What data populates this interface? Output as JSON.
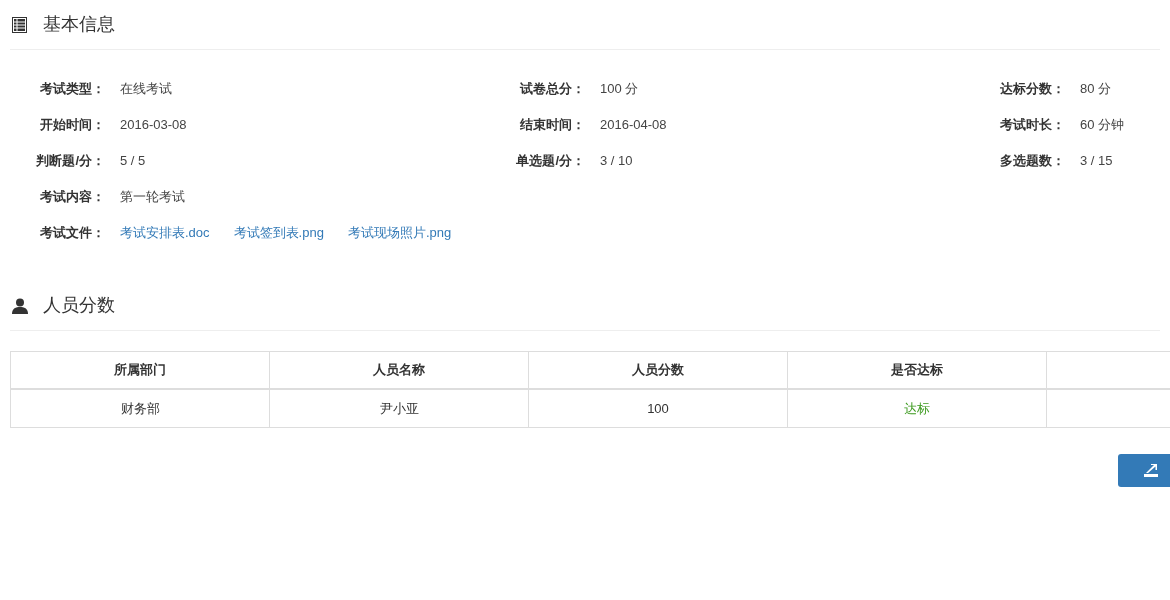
{
  "basic_info": {
    "title": "基本信息",
    "rows": [
      [
        {
          "label": "考试类型：",
          "value": "在线考试"
        },
        {
          "label": "试卷总分：",
          "value": "100 分"
        },
        {
          "label": "达标分数：",
          "value": "80 分"
        }
      ],
      [
        {
          "label": "开始时间：",
          "value": "2016-03-08"
        },
        {
          "label": "结束时间：",
          "value": "2016-04-08"
        },
        {
          "label": "考试时长：",
          "value": "60 分钟"
        }
      ],
      [
        {
          "label": "判断题/分：",
          "value": "5 / 5"
        },
        {
          "label": "单选题/分：",
          "value": "3 / 10"
        },
        {
          "label": "多选题数：",
          "value": "3 / 15"
        }
      ],
      [
        {
          "label": "考试内容：",
          "value": "第一轮考试"
        }
      ]
    ],
    "files": {
      "label": "考试文件：",
      "links": [
        "考试安排表.doc",
        "考试签到表.png",
        "考试现场照片.png"
      ]
    }
  },
  "scores": {
    "title": "人员分数",
    "table": {
      "columns": [
        "所属部门",
        "人员名称",
        "人员分数",
        "是否达标"
      ],
      "rows": [
        {
          "department": "财务部",
          "name": "尹小亚",
          "score": "100",
          "status": "达标",
          "passed": true
        }
      ]
    }
  }
}
